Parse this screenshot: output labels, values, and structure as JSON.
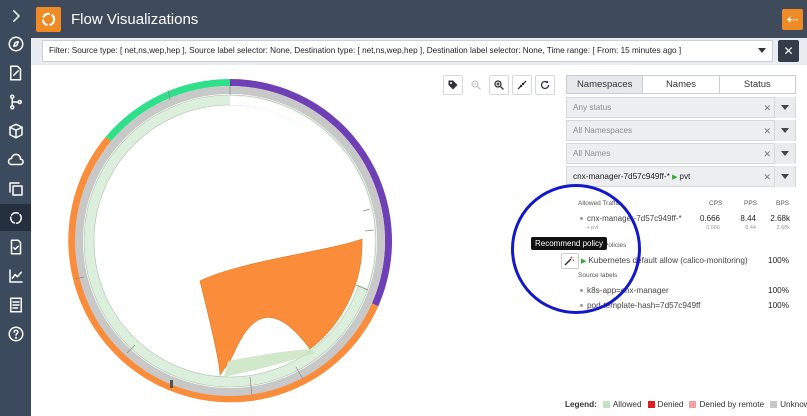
{
  "header": {
    "title": "Flow Visualizations",
    "back_icon": "arrow-left-icon"
  },
  "filter": {
    "text": "Filter: Source type: [ net,ns,wep,hep ], Source label selector: None, Destination type: [ net,ns,wep,hep ], Destination label selector: None, Time range: [ From: 15 minutes ago ]",
    "clear_label": "✕"
  },
  "sidebar": {
    "items": [
      {
        "icon": "chevron-right-icon"
      },
      {
        "icon": "compass-icon"
      },
      {
        "icon": "edit-doc-icon"
      },
      {
        "icon": "branch-icon"
      },
      {
        "icon": "cube-icon"
      },
      {
        "icon": "cloud-upload-icon"
      },
      {
        "icon": "copy-icon"
      },
      {
        "icon": "flow-ring-icon"
      },
      {
        "icon": "checklist-doc-icon"
      },
      {
        "icon": "chart-icon"
      },
      {
        "icon": "list-doc-icon"
      },
      {
        "icon": "help-icon"
      }
    ]
  },
  "toolbar": {
    "buttons": [
      "tag-icon",
      "zoom-out-icon",
      "zoom-in-icon",
      "collapse-icon",
      "refresh-icon"
    ]
  },
  "panel": {
    "tabs": [
      "Namespaces",
      "Names",
      "Status"
    ],
    "status_select": "Any status",
    "namespace_select": "All Namespaces",
    "names_select": "All Names",
    "selected_select": "cnx-manager-7d57c949ff-*",
    "selected_target": "pvt",
    "allowed_traffic": "Allowed Traffic",
    "col_cps": "CPS",
    "col_pps": "PPS",
    "col_bps": "BPS",
    "flow_name": "cnx-manager-7d57c949ff-*",
    "flow_sub": "⇢ pvt",
    "cps": "0.666",
    "pps": "8.44",
    "bps": "2.68k",
    "cps_sub": "0.666",
    "pps_sub": "8.44",
    "bps_sub": "2.68k",
    "policies_label": "Policies",
    "policy_name": "Kubernetes default allow (calico-monitoring)",
    "policy_pct": "100%",
    "source_labels": "Source labels",
    "labels": [
      {
        "text": "k8s-app=cnx-manager",
        "pct": "100%"
      },
      {
        "text": "pod-template-hash=7d57c949ff",
        "pct": "100%"
      }
    ]
  },
  "tooltip": "Recommend policy",
  "legend": {
    "title": "Legend:",
    "items": [
      {
        "label": "Allowed",
        "color": "#bfe3bf"
      },
      {
        "label": "Denied",
        "color": "#e02020"
      },
      {
        "label": "Denied by remote",
        "color": "#f4a0a0"
      },
      {
        "label": "Unknown",
        "color": "#c8c8c8"
      }
    ]
  },
  "colors": {
    "orange": "#fb8c3a",
    "purple": "#6f3fb5",
    "green": "#2ee08a",
    "accent": "#f08a24"
  }
}
